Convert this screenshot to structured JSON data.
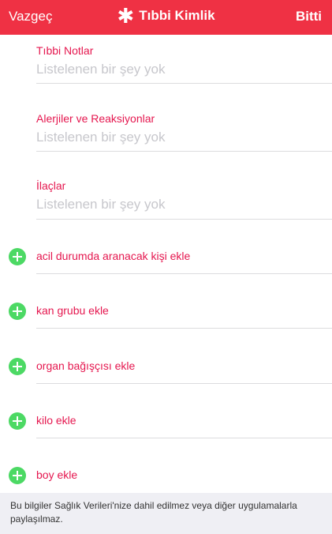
{
  "navbar": {
    "cancel": "Vazgeç",
    "title": "Tıbbi Kimlik",
    "title_icon": "asterisk-icon",
    "done": "Bitti",
    "color": "#ef3144"
  },
  "fields": [
    {
      "label": "Tıbbi Notlar",
      "placeholder": "Listelenen bir şey yok"
    },
    {
      "label": "Alerjiler ve Reaksiyonlar",
      "placeholder": "Listelenen bir şey yok"
    },
    {
      "label": "İlaçlar",
      "placeholder": "Listelenen bir şey yok"
    }
  ],
  "add_rows": [
    {
      "label": "acil durumda aranacak kişi ekle",
      "icon": "add-circle-icon"
    },
    {
      "label": "kan grubu ekle",
      "icon": "add-circle-icon"
    },
    {
      "label": "organ bağışçısı ekle",
      "icon": "add-circle-icon"
    },
    {
      "label": "kilo ekle",
      "icon": "add-circle-icon"
    },
    {
      "label": "boy ekle",
      "icon": "add-circle-icon"
    }
  ],
  "footer": {
    "note": "Bu bilgiler Sağlık Verileri'nize dahil edilmez veya diğer uygulamalarla paylaşılmaz."
  },
  "colors": {
    "accent_text": "#e5174f",
    "add_icon": "#4cd964",
    "placeholder": "#c7c7cc"
  }
}
